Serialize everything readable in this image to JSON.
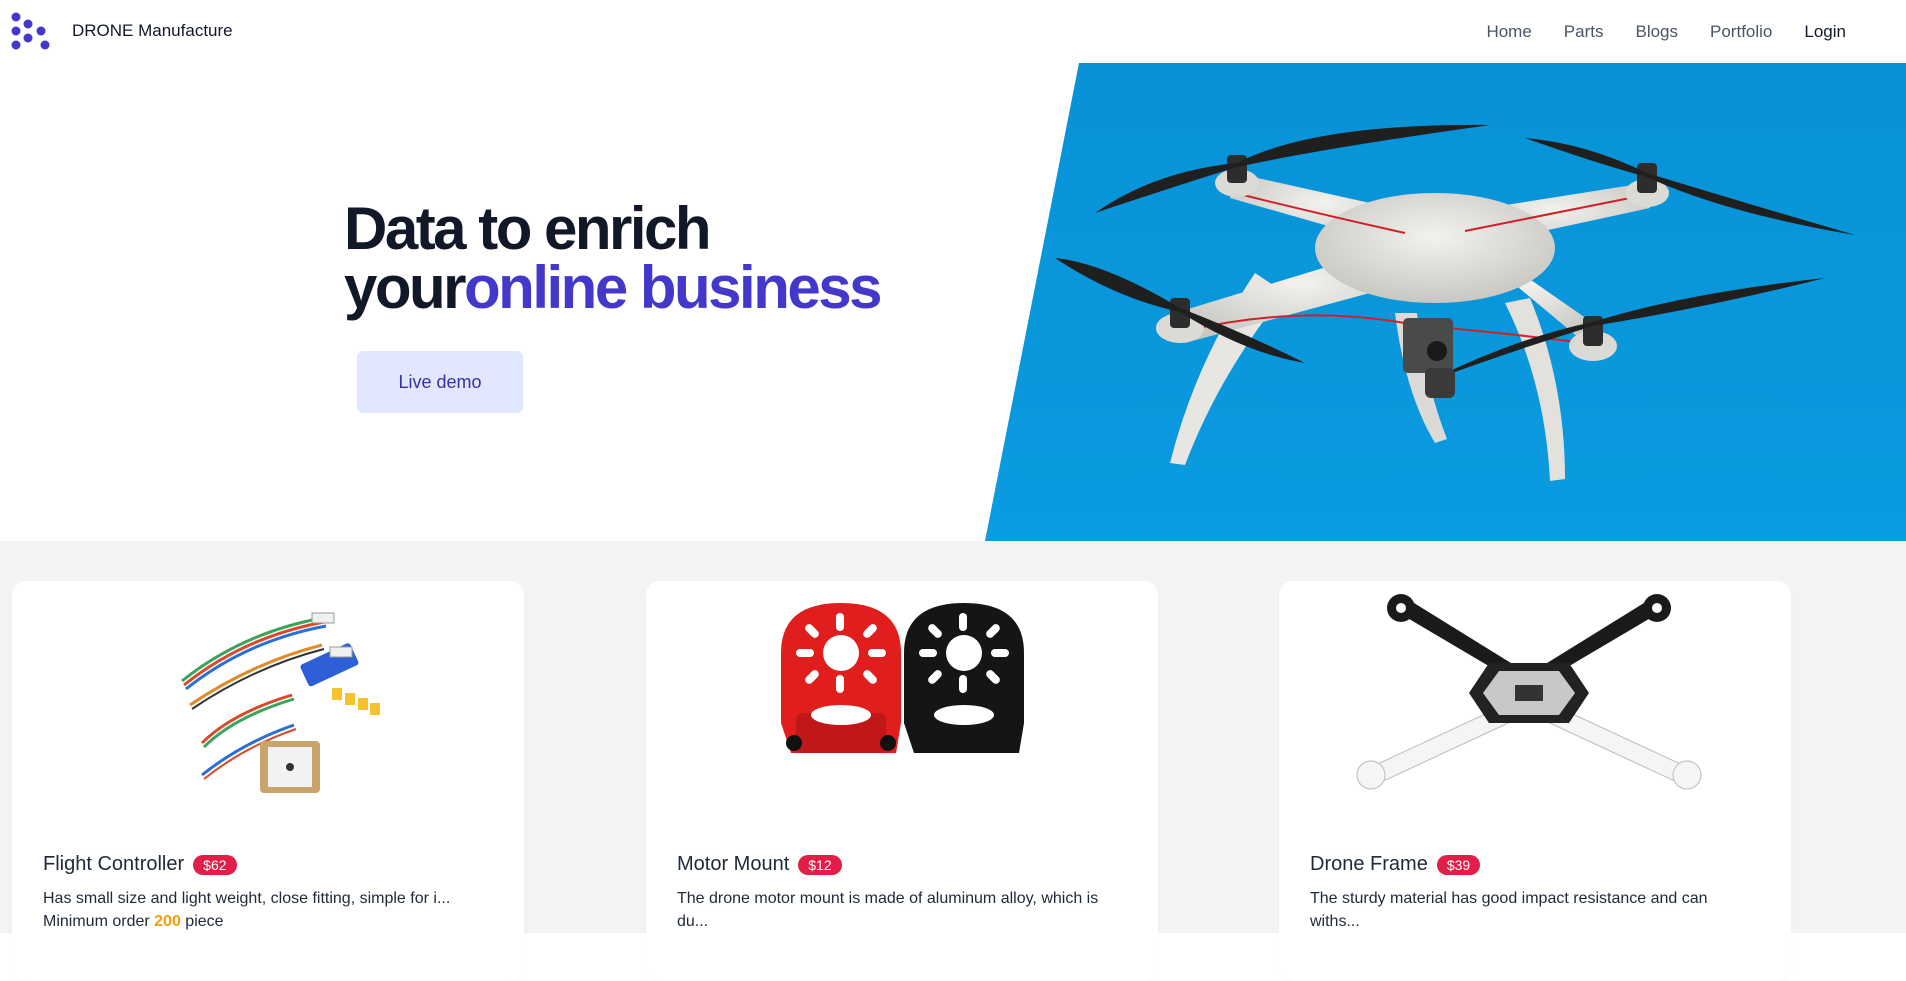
{
  "brand": {
    "name": "DRONE Manufacture",
    "logo_icon": "dots-logo-icon"
  },
  "nav": {
    "items": [
      {
        "label": "Home"
      },
      {
        "label": "Parts"
      },
      {
        "label": "Blogs"
      },
      {
        "label": "Portfolio"
      },
      {
        "label": "Login"
      }
    ]
  },
  "hero": {
    "title_line1": "Data to enrich",
    "title_line2_prefix": "your",
    "title_line2_accent": "online business",
    "cta_label": "Live demo"
  },
  "products": [
    {
      "name": "Flight Controller",
      "price": "$62",
      "description": "Has small size and light weight, close fitting, simple for i...",
      "min_order_prefix": "Minimum order",
      "min_order_qty": "200",
      "min_order_suffix": "piece"
    },
    {
      "name": "Motor Mount",
      "price": "$12",
      "description": "The drone motor mount is made of aluminum alloy, which is du..."
    },
    {
      "name": "Drone Frame",
      "price": "$39",
      "description": "The sturdy material has good impact resistance and can withs..."
    }
  ],
  "colors": {
    "accent": "#4338ca",
    "badge": "#e11d48",
    "hero_bg": "#0894d8",
    "quantity": "#f59e0b"
  }
}
